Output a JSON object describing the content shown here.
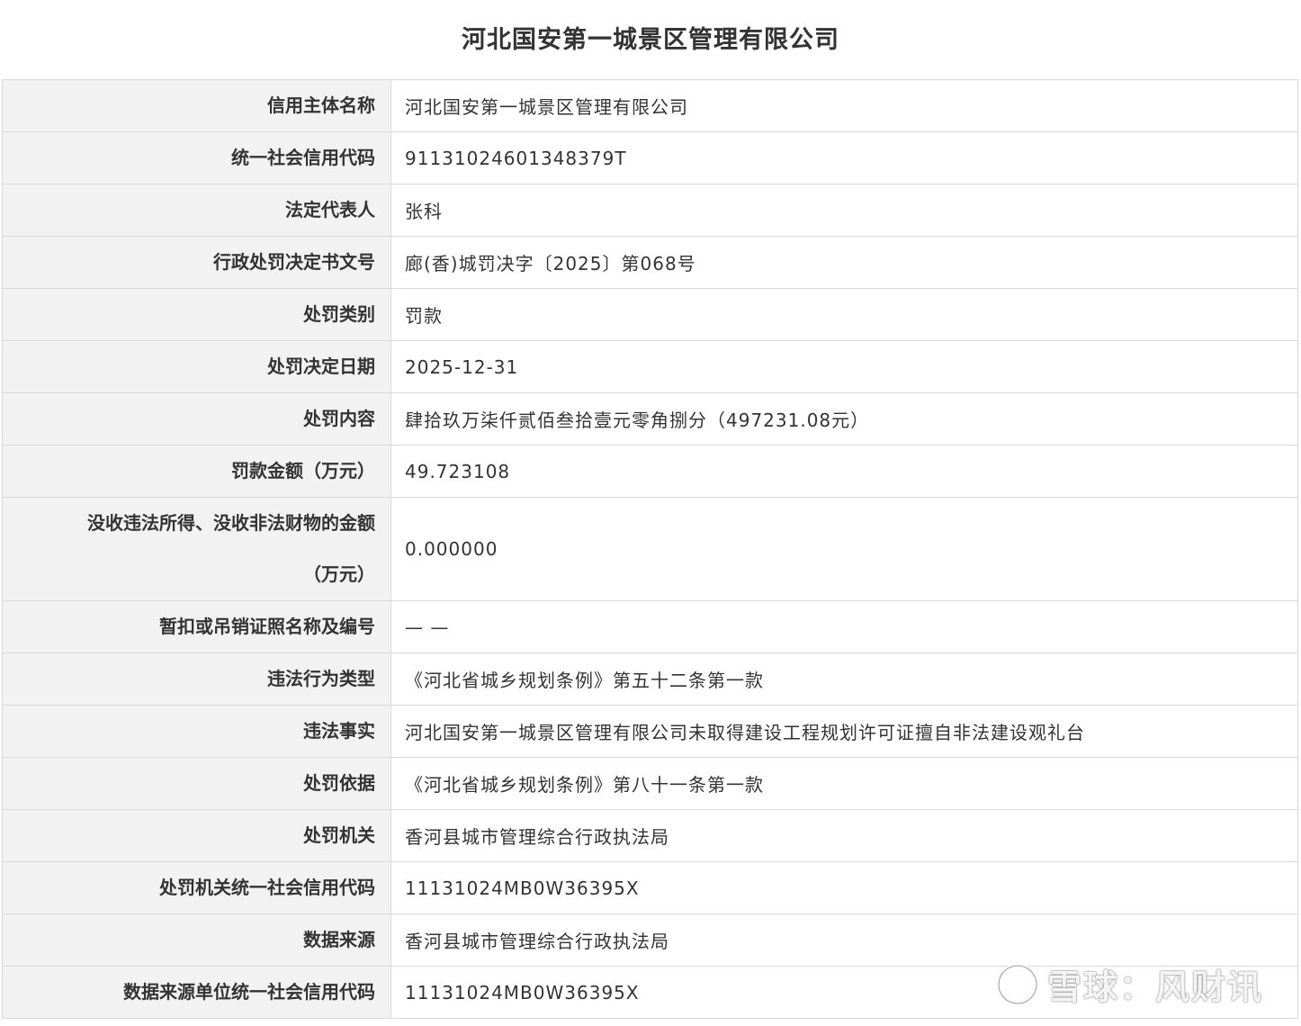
{
  "title": "河北国安第一城景区管理有限公司",
  "rows": [
    {
      "label": "信用主体名称",
      "value": "河北国安第一城景区管理有限公司"
    },
    {
      "label": "统一社会信用代码",
      "value": "91131024601348379T"
    },
    {
      "label": "法定代表人",
      "value": "张科"
    },
    {
      "label": "行政处罚决定书文号",
      "value": "廊(香)城罚决字〔2025〕第068号"
    },
    {
      "label": "处罚类别",
      "value": "罚款"
    },
    {
      "label": "处罚决定日期",
      "value": "2025-12-31"
    },
    {
      "label": "处罚内容",
      "value": "肆拾玖万柒仟贰佰叁拾壹元零角捌分（497231.08元）"
    },
    {
      "label": "罚款金额（万元）",
      "value": "49.723108"
    },
    {
      "label_line1": "没收违法所得、没收非法财物的金额",
      "label_line2": "（万元）",
      "value": "0.000000"
    },
    {
      "label": "暂扣或吊销证照名称及编号",
      "value": "— —"
    },
    {
      "label": "违法行为类型",
      "value": "《河北省城乡规划条例》第五十二条第一款"
    },
    {
      "label": "违法事实",
      "value": "河北国安第一城景区管理有限公司未取得建设工程规划许可证擅自非法建设观礼台"
    },
    {
      "label": "处罚依据",
      "value": "《河北省城乡规划条例》第八十一条第一款"
    },
    {
      "label": "处罚机关",
      "value": "香河县城市管理综合行政执法局"
    },
    {
      "label": "处罚机关统一社会信用代码",
      "value": "11131024MB0W36395X"
    },
    {
      "label": "数据来源",
      "value": "香河县城市管理综合行政执法局"
    },
    {
      "label": "数据来源单位统一社会信用代码",
      "value": "11131024MB0W36395X"
    }
  ],
  "watermark": {
    "text": "雪球：风财讯",
    "icon": "snowball-logo-icon"
  }
}
